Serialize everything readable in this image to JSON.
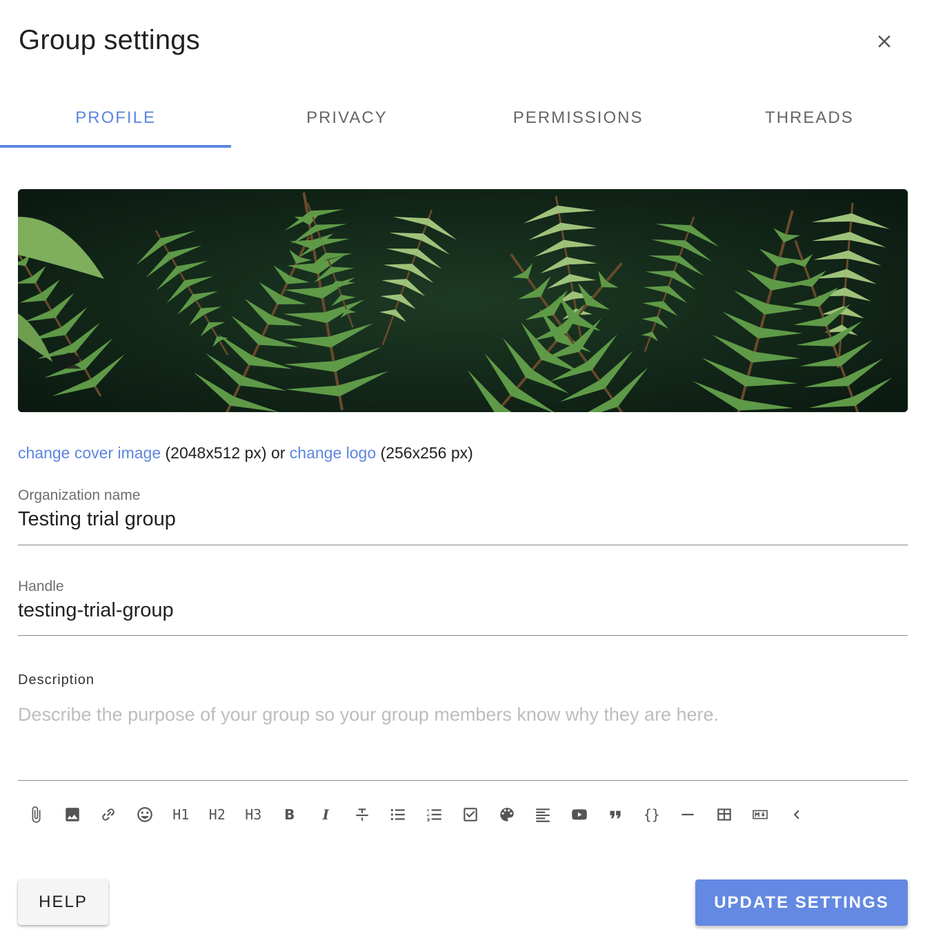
{
  "dialog": {
    "title": "Group settings"
  },
  "tabs": [
    {
      "label": "PROFILE",
      "active": true
    },
    {
      "label": "PRIVACY",
      "active": false
    },
    {
      "label": "PERMISSIONS",
      "active": false
    },
    {
      "label": "THREADS",
      "active": false
    }
  ],
  "cover": {
    "change_cover_label": "change cover image",
    "cover_size": "(2048x512 px)",
    "or_text": "or",
    "change_logo_label": "change logo",
    "logo_size": "(256x256 px)"
  },
  "fields": {
    "org_name": {
      "label": "Organization name",
      "value": "Testing trial group"
    },
    "handle": {
      "label": "Handle",
      "value": "testing-trial-group"
    }
  },
  "description": {
    "label": "Description",
    "placeholder": "Describe the purpose of your group so your group members know why they are here."
  },
  "toolbar": {
    "h1": "H1",
    "h2": "H2",
    "h3": "H3",
    "bold": "B",
    "italic": "I",
    "code": "{}"
  },
  "buttons": {
    "help": "HELP",
    "update": "UPDATE SETTINGS"
  },
  "colors": {
    "accent": "#5c86e0",
    "primary_button": "#6489e3"
  }
}
